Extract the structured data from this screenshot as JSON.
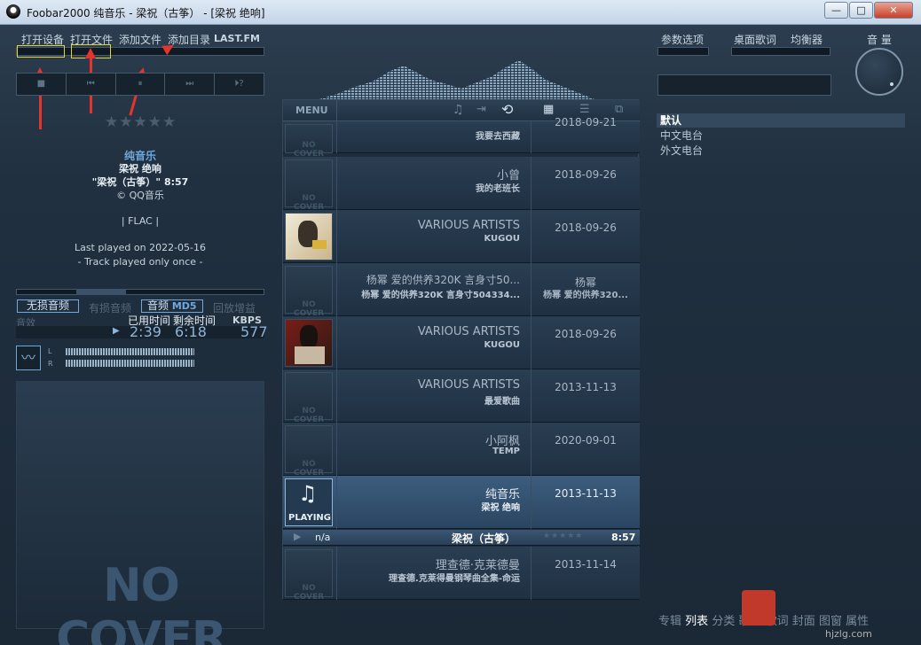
{
  "window": {
    "title": "Foobar2000  纯音乐 - 梁祝（古筝） - [梁祝 绝响]",
    "minimize": "—",
    "maximize": "□",
    "close": "✕"
  },
  "top_links": {
    "open_device": "打开设备",
    "open_file": "打开文件",
    "add_file": "添加文件",
    "add_dir": "添加目录",
    "lastfm": "LAST.FM",
    "params": "参数选项",
    "desktop_lyrics": "桌面歌词",
    "equalizer": "均衡器",
    "volume": "音 量"
  },
  "transport": [
    "■",
    "⏮",
    "⏸",
    "⏭",
    "⏵?"
  ],
  "rating": "★★★★★",
  "now": {
    "album": "纯音乐",
    "artist": "梁祝 绝响",
    "title": "\"梁祝（古筝）\"",
    "duration": "8:57",
    "copyright": "© QQ音乐",
    "format": "| FLAC |",
    "last_played": "Last played on 2022-05-16",
    "track_played": "- Track played only once -"
  },
  "quality": {
    "lossless": "无损音频",
    "lossy": "有损音频",
    "audio": "音频",
    "md5": "MD5",
    "replay": "回放增益",
    "effects": "音效",
    "elapsed_label": "已用时间",
    "remaining_label": "剩余时间",
    "kbps_label": "KBPS",
    "elapsed": "2:39",
    "remaining": "6:18",
    "kbps": "577",
    "left_ch": "L",
    "right_ch": "R"
  },
  "left_nocover": "NO COVER",
  "panel": {
    "menu": "MENU"
  },
  "playlist": [
    {
      "cover": "NO COVER",
      "t1": "",
      "t2": "我要去西藏",
      "d": "2018-09-21"
    },
    {
      "cover": "NO COVER",
      "t1": "小曾",
      "t2": "我的老班长",
      "d": "2018-09-26"
    },
    {
      "cover": "img1",
      "t1": "VARIOUS ARTISTS",
      "t2": "KUGOU",
      "d": "2018-09-26"
    },
    {
      "cover": "NO COVER",
      "t1": "杨幂 爱的供养320K 言身寸50...",
      "t2": "杨幂 爱的供养320K 言身寸504334...",
      "d": "杨幂",
      "d2": "杨幂 爱的供养320..."
    },
    {
      "cover": "img2",
      "t1": "VARIOUS ARTISTS",
      "t2": "KUGOU",
      "d": "2018-09-26"
    },
    {
      "cover": "NO COVER",
      "t1": "VARIOUS ARTISTS",
      "t2": "最爱歌曲",
      "d": "2013-11-13"
    },
    {
      "cover": "NO COVER",
      "t1": "小阿枫",
      "t2": "TEMP",
      "d": "2020-09-01"
    },
    {
      "cover": "PLAYING",
      "t1": "纯音乐",
      "t2": "梁祝 绝响",
      "d": "2013-11-13"
    },
    {
      "cover": "NO COVER",
      "t1": "理查德·克莱德曼",
      "t2": "理查德.克莱得曼钢琴曲全集-命运",
      "d": "2013-11-14"
    }
  ],
  "nowrow": {
    "na": "n/a",
    "title": "梁祝（古筝）",
    "stars": "★★★★★",
    "time": "8:57"
  },
  "radio": [
    "默认",
    "中文电台",
    "外文电台"
  ],
  "bottom_tabs": [
    "专辑",
    "列表",
    "分类",
    "歌手",
    "歌词",
    "封面",
    "图窗",
    "属性"
  ],
  "watermark": {
    "text": "hjzlg.com"
  }
}
